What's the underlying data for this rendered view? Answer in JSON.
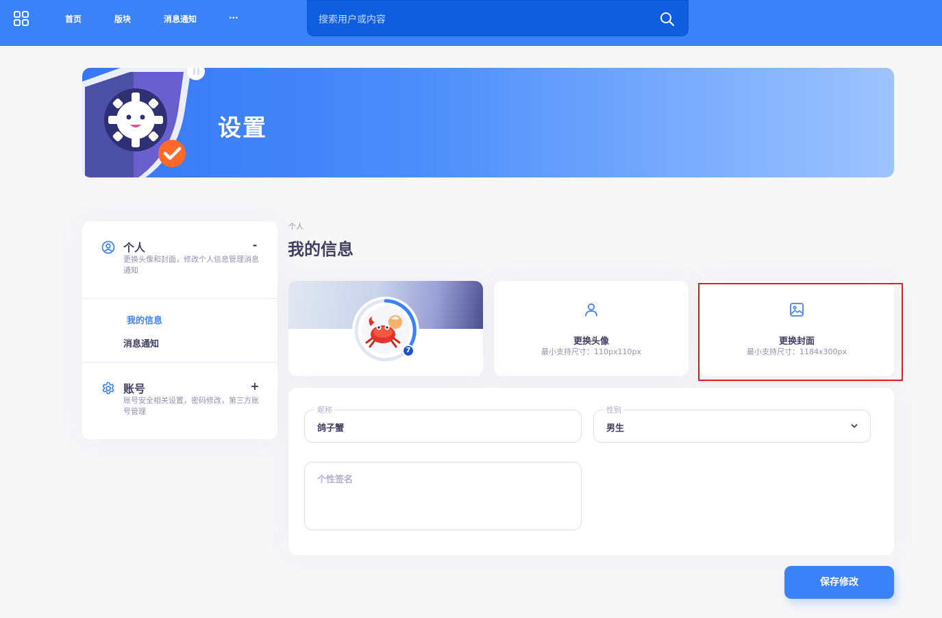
{
  "nav": {
    "links": [
      "首页",
      "版块",
      "消息通知",
      "···"
    ],
    "search_placeholder": "搜索用户或内容"
  },
  "banner": {
    "title": "设置"
  },
  "sidebar": {
    "personal": {
      "title": "个人",
      "description": "更换头像和封面，修改个人信息管理消息通知",
      "toggle": "-",
      "items": [
        {
          "label": "我的信息",
          "active": true
        },
        {
          "label": "消息通知",
          "active": false
        }
      ]
    },
    "account": {
      "title": "账号",
      "description": "账号安全相关设置，密码修改，第三方账号管理",
      "toggle": "+"
    }
  },
  "main": {
    "breadcrumb": "个人",
    "title": "我的信息",
    "profile": {
      "level": "7"
    },
    "upload_avatar": {
      "title": "更换头像",
      "hint": "最小支持尺寸：110px110px"
    },
    "upload_cover": {
      "title": "更换封面",
      "hint": "最小支持尺寸：1184x300px"
    },
    "form": {
      "nickname": {
        "label": "昵称",
        "value": "鸽子蟹"
      },
      "gender": {
        "label": "性别",
        "value": "男生"
      },
      "signature": {
        "placeholder": "个性签名"
      }
    },
    "save_label": "保存修改"
  },
  "colors": {
    "primary": "#3b82f8",
    "search_bg": "#0f5ee0",
    "active_link": "#3b82f8",
    "highlight_box": "#e31b1b"
  }
}
